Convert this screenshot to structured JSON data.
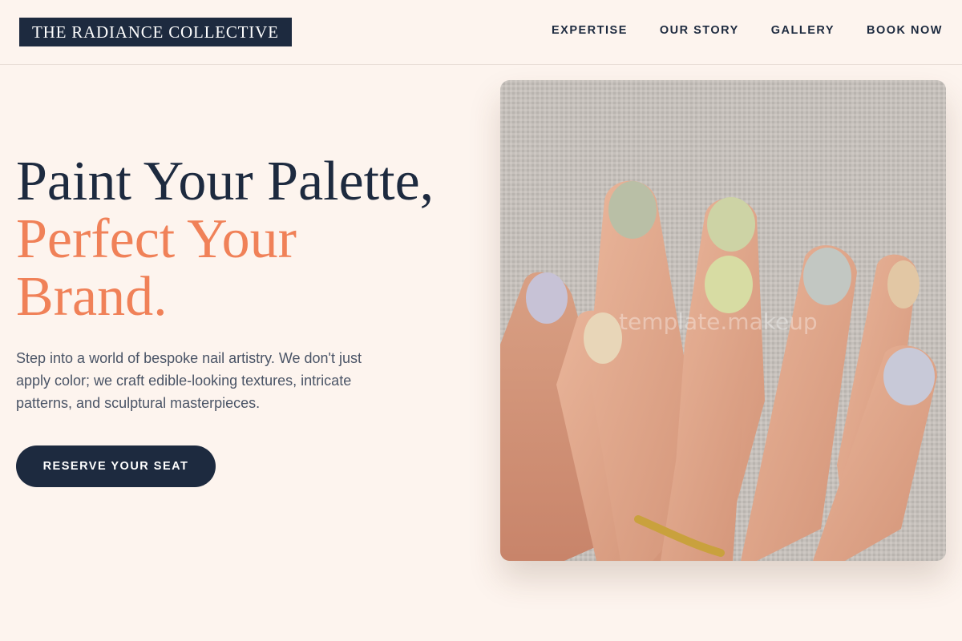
{
  "brand": {
    "name": "THE RADIANCE COLLECTIVE"
  },
  "nav": {
    "items": [
      {
        "label": "EXPERTISE"
      },
      {
        "label": "OUR STORY"
      },
      {
        "label": "GALLERY"
      },
      {
        "label": "BOOK NOW"
      }
    ]
  },
  "hero": {
    "title_line1": "Paint Your Palette,",
    "title_line2": "Perfect Your Brand.",
    "description": "Step into a world of bespoke nail artistry. We don't just apply color; we craft edible-looking textures, intricate patterns, and sculptural masterpieces.",
    "cta_label": "RESERVE YOUR SEAT",
    "image_watermark": "template.makeup"
  },
  "colors": {
    "background": "#fdf4ee",
    "navy": "#1d2a3f",
    "accent": "#f08158",
    "body_text": "#4a5466"
  }
}
